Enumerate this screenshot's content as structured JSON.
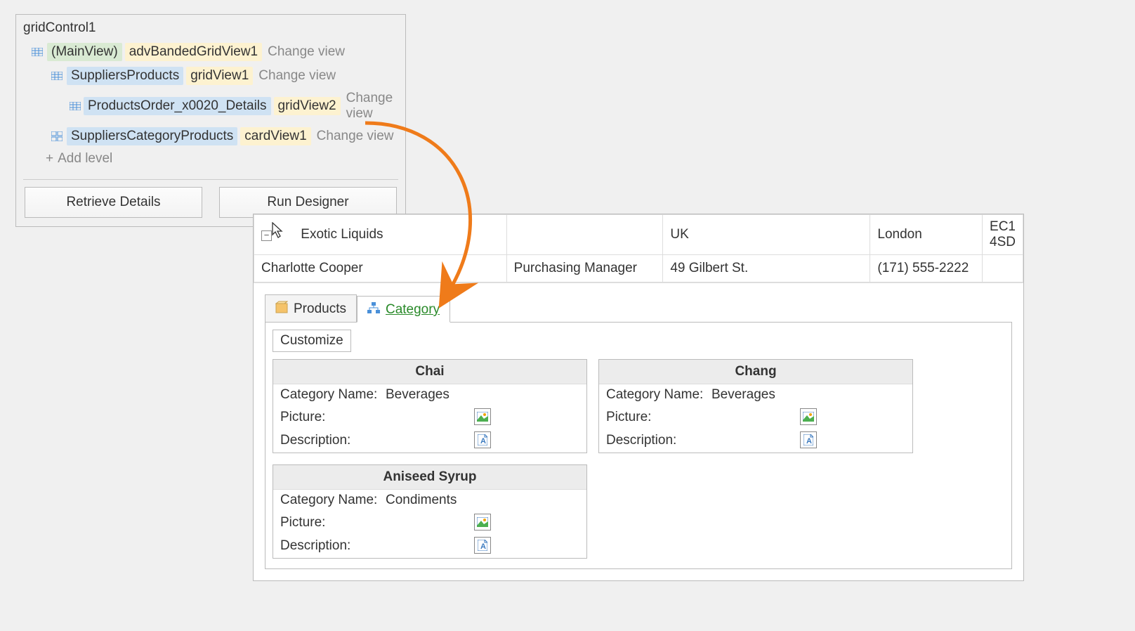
{
  "designer": {
    "title": "gridControl1",
    "rows": [
      {
        "indent": 0,
        "icon": "grid",
        "label_class": "pill-green",
        "label": "(MainView)",
        "view_class": "pill-yellow",
        "view": "advBandedGridView1",
        "change": "Change view"
      },
      {
        "indent": 1,
        "icon": "grid",
        "label_class": "pill-blue",
        "label": "SuppliersProducts",
        "view_class": "pill-yellow",
        "view": "gridView1",
        "change": "Change view"
      },
      {
        "indent": 2,
        "icon": "grid",
        "label_class": "pill-blue",
        "label": "ProductsOrder_x0020_Details",
        "view_class": "pill-yellow",
        "view": "gridView2",
        "change": "Change view"
      },
      {
        "indent": 1,
        "icon": "card",
        "label_class": "pill-blue",
        "label": "SuppliersCategoryProducts",
        "view_class": "pill-yellow",
        "view": "cardView1",
        "change": "Change view"
      }
    ],
    "add_level": "Add level",
    "retrieve_details": "Retrieve Details",
    "run_designer": "Run Designer"
  },
  "grid": {
    "row1": {
      "company": "Exotic Liquids",
      "blank": "",
      "c3": "UK",
      "c4": "London",
      "c5": "EC1 4SD"
    },
    "row2": {
      "c1": "Charlotte Cooper",
      "c2": "Purchasing Manager",
      "c3": "49 Gilbert St.",
      "c4": "(171) 555-2222",
      "c5": ""
    },
    "tabs": {
      "products": "Products",
      "category": "Category"
    },
    "customize": "Customize",
    "field_category": "Category Name:",
    "field_picture": "Picture:",
    "field_description": "Description:",
    "cards": [
      {
        "title": "Chai",
        "category": "Beverages"
      },
      {
        "title": "Chang",
        "category": "Beverages"
      },
      {
        "title": "Aniseed Syrup",
        "category": "Condiments"
      }
    ]
  }
}
